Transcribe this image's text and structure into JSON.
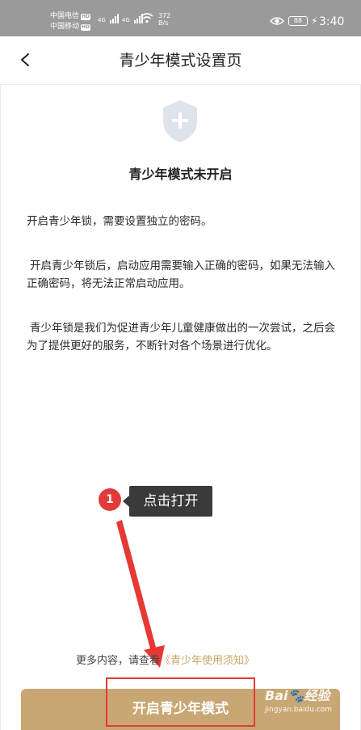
{
  "status_bar": {
    "carrier_1": "中国电信",
    "carrier_2": "中国移动",
    "hd_badge": "HD",
    "signal_label": "4G",
    "net_speed_value": "372",
    "net_speed_unit": "B/s",
    "battery": "88",
    "time": "3:40",
    "icons": [
      "wifi-icon",
      "eye-icon",
      "bolt-icon"
    ]
  },
  "header": {
    "back_icon": "chevron-left-icon",
    "title": "青少年模式设置页"
  },
  "main": {
    "shield_icon": "shield-plus-icon",
    "status_title": "青少年模式未开启",
    "paragraphs": [
      "开启青少年锁，需要设置独立的密码。",
      "开启青少年锁后，启动应用需要输入正确的密码，如果无法输入正确密码，将无法正常启动应用。",
      "青少年锁是我们为促进青少年儿童健康做出的一次尝试，之后会为了提供更好的服务，不断针对各个场景进行优化。"
    ]
  },
  "annotation": {
    "step_number": "1",
    "label": "点击打开",
    "color": "#e53935"
  },
  "footer": {
    "note_prefix": "更多内容，请查看",
    "note_link": "《青少年使用须知》",
    "button_label": "开启青少年模式"
  },
  "watermark": {
    "logo": "Bai🐾经验",
    "url": "jingyan.baidu.com"
  },
  "colors": {
    "accent": "#c8a774",
    "link": "#c9a566",
    "status_bar": "#9a9a9a",
    "annotation_red": "#e53935"
  }
}
